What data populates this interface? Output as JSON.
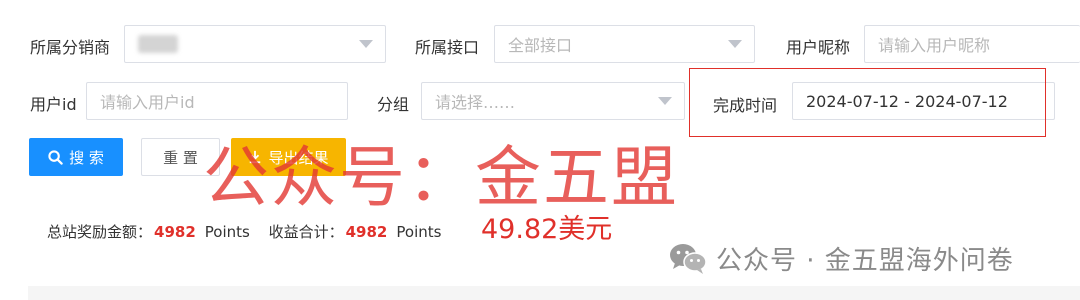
{
  "filters": {
    "distributor": {
      "label": "所属分销商"
    },
    "interface": {
      "label": "所属接口",
      "value": "全部接口"
    },
    "nickname": {
      "label": "用户昵称",
      "placeholder": "请输入用户昵称"
    },
    "user_id": {
      "label": "用户id",
      "placeholder": "请输入用户id"
    },
    "group": {
      "label": "分组",
      "value": "请选择……"
    },
    "completion_time": {
      "label": "完成时间",
      "value": "2024-07-12 - 2024-07-12"
    }
  },
  "actions": {
    "search_label": "搜 索",
    "reset_label": "重 置",
    "export_label": "导出结果"
  },
  "summary": {
    "total_label": "总站奖励金额：",
    "total_value": "4982",
    "total_unit": "Points",
    "income_label": "收益合计：",
    "income_value": "4982",
    "income_unit": "Points"
  },
  "annotation": {
    "usd": "49.82美元"
  },
  "watermarks": {
    "big": "公众号：金五盟",
    "small": "公众号 · 金五盟海外问卷"
  },
  "colors": {
    "primary": "#1890ff",
    "warning": "#f7b500",
    "highlight": "#e0302a"
  },
  "icons": {
    "search": "search-icon",
    "dropdown": "chevron-down-icon",
    "wechat": "wechat-icon"
  }
}
